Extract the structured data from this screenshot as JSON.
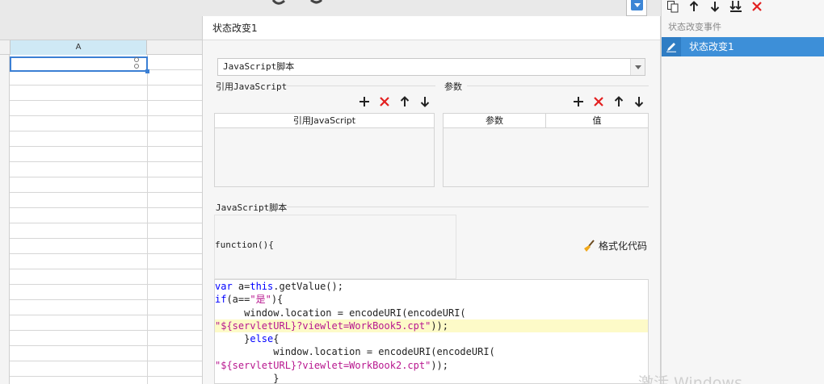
{
  "sheet": {
    "column_header": "A"
  },
  "dialog": {
    "title": "状态改变1",
    "script_type_selected": "JavaScript脚本",
    "ref_section": {
      "label": "引用JavaScript",
      "table_headers": [
        "引用JavaScript"
      ]
    },
    "param_section": {
      "label": "参数",
      "table_headers": [
        "参数",
        "值"
      ]
    },
    "script_section_label": "JavaScript脚本",
    "function_header": "function(){",
    "format_code_label": "格式化代码"
  },
  "code_lines": [
    {
      "parts": [
        {
          "t": "var ",
          "c": "kw"
        },
        {
          "t": "a=",
          "c": ""
        },
        {
          "t": "this",
          "c": "kw"
        },
        {
          "t": ".getValue();",
          "c": ""
        }
      ],
      "highlight": false
    },
    {
      "parts": [
        {
          "t": "if",
          "c": "kw"
        },
        {
          "t": "(a==",
          "c": ""
        },
        {
          "t": "\"是\"",
          "c": "str"
        },
        {
          "t": "){",
          "c": ""
        }
      ],
      "highlight": false
    },
    {
      "parts": [
        {
          "t": "     window.location = encodeURI(encodeURI(",
          "c": ""
        }
      ],
      "highlight": false
    },
    {
      "parts": [
        {
          "t": "\"${servletURL}?viewlet=WorkBook5.cpt\"",
          "c": "str"
        },
        {
          "t": "));",
          "c": ""
        }
      ],
      "highlight": true
    },
    {
      "parts": [
        {
          "t": "     }",
          "c": ""
        },
        {
          "t": "else",
          "c": "kw"
        },
        {
          "t": "{",
          "c": ""
        }
      ],
      "highlight": false
    },
    {
      "parts": [
        {
          "t": "          window.location = encodeURI(encodeURI(",
          "c": ""
        }
      ],
      "highlight": false
    },
    {
      "parts": [
        {
          "t": "\"${servletURL}?viewlet=WorkBook2.cpt\"",
          "c": "str"
        },
        {
          "t": "));",
          "c": ""
        }
      ],
      "highlight": false
    },
    {
      "parts": [
        {
          "t": "          }",
          "c": ""
        }
      ],
      "highlight": false
    }
  ],
  "right_panel": {
    "list_label": "状态改变事件",
    "events": [
      "状态改变1"
    ]
  },
  "watermark": "激活 Windows",
  "colors": {
    "accent": "#3d8fd8",
    "delete_red": "#e32020",
    "keyword": "#0000ff",
    "string": "#b8178f",
    "highlight_line": "#fdfac8"
  }
}
